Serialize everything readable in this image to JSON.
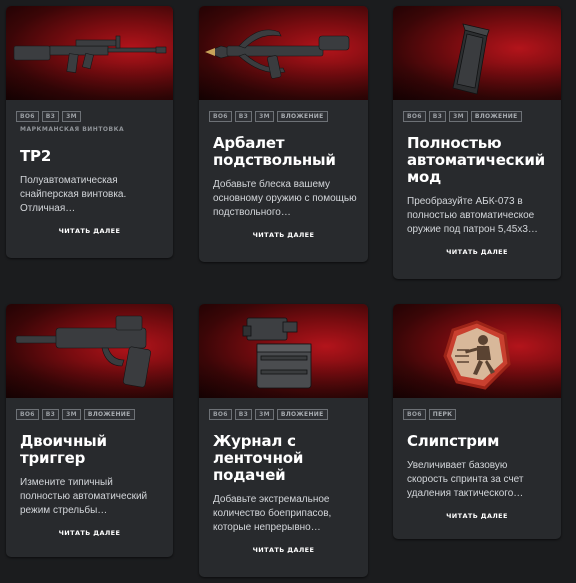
{
  "cards": [
    {
      "tags": [
        "BO6",
        "B3",
        "3M"
      ],
      "subtitle": "МАРКМАНСКАЯ ВИНТОВКА",
      "title": "TP2",
      "desc": "Полуавтоматическая снайперская винтовка. Отличная…",
      "more": "ЧИТАТЬ ДАЛЕЕ",
      "icon": "rifle-icon"
    },
    {
      "tags": [
        "BO6",
        "B3",
        "3M",
        "ВЛОЖЕНИЕ"
      ],
      "title": "Арбалет подствольный",
      "desc": "Добавьте блеска вашему основному оружию с помощью подствольного…",
      "more": "ЧИТАТЬ ДАЛЕЕ",
      "icon": "crossbow-icon"
    },
    {
      "tags": [
        "BO6",
        "B3",
        "3M",
        "ВЛОЖЕНИЕ"
      ],
      "title": "Полностью автоматический мод",
      "desc": "Преобразуйте АБК-073 в полностью автоматическое оружие под патрон 5,45x3…",
      "more": "ЧИТАТЬ ДАЛЕЕ",
      "icon": "magazine-icon"
    },
    {
      "tags": [
        "BO6",
        "B3",
        "3M",
        "ВЛОЖЕНИЕ"
      ],
      "title": "Двоичный триггер",
      "desc": "Измените типичный полностью автоматический режим стрельбы…",
      "more": "ЧИТАТЬ ДАЛЕЕ",
      "icon": "pistol-trigger-icon"
    },
    {
      "tags": [
        "BO6",
        "B3",
        "3M",
        "ВЛОЖЕНИЕ"
      ],
      "title": "Журнал с ленточной подачей",
      "desc": "Добавьте экстремальное количество боеприпасов, которые непрерывно…",
      "more": "ЧИТАТЬ ДАЛЕЕ",
      "icon": "ammo-box-icon"
    },
    {
      "tags": [
        "BO6",
        "ПЕРК"
      ],
      "title": "Слипстрим",
      "desc": "Увеличивает базовую скорость спринта за счет удаления тактического…",
      "more": "ЧИТАТЬ ДАЛЕЕ",
      "icon": "running-soldier-icon"
    }
  ]
}
